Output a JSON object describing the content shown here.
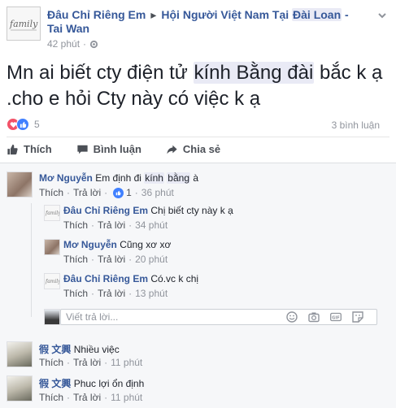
{
  "header": {
    "author": "Đâu Chỉ Riêng Em",
    "group_part1": "Hội Người Việt Nam Tại",
    "group_part2": "Đài Loan",
    "group_part3": "-",
    "group_line2": "Tai Wan",
    "time": "42 phút",
    "logo_text": "family"
  },
  "post": {
    "text_a": "Mn ai biết cty điện tử",
    "text_hl": "kính Bằng đài",
    "text_b": "bắc k ạ .cho e hỏi Cty này có việc k ạ"
  },
  "stats": {
    "reaction_count": "5",
    "comment_count": "3 bình luận"
  },
  "actions": {
    "like": "Thích",
    "comment": "Bình luận",
    "share": "Chia sẻ"
  },
  "comments": [
    {
      "author": "Mơ Nguyễn",
      "text_a": "Em định đi",
      "text_hl1": "kính",
      "text_hl2": "bằng",
      "text_b": "à",
      "like": "Thích",
      "reply": "Trả lời",
      "likes": "1",
      "time": "36 phút"
    },
    {
      "author": "Đâu Chỉ Riêng Em",
      "text": "Chị biết cty này k ạ",
      "like": "Thích",
      "reply": "Trả lời",
      "time": "34 phút"
    },
    {
      "author": "Mơ Nguyễn",
      "text": "Cũng xơ xơ",
      "like": "Thích",
      "reply": "Trả lời",
      "time": "20 phút"
    },
    {
      "author": "Đâu Chỉ Riêng Em",
      "text": "Có.vc k chị",
      "like": "Thích",
      "reply": "Trả lời",
      "time": "13 phút"
    },
    {
      "author": "徦 文興",
      "text": "Nhiều việc",
      "like": "Thích",
      "reply": "Trả lời",
      "time": "11 phút"
    },
    {
      "author": "徦 文興",
      "text": "Phuc lợi ổn định",
      "like": "Thích",
      "reply": "Trả lời",
      "time": "11 phút"
    }
  ],
  "reply_box": {
    "placeholder": "Viết trả lời..."
  },
  "colors": {
    "link": "#365899",
    "like_blue": "#4080ff",
    "love_red": "#f25268",
    "highlight": "#e9eaf5",
    "comment_bg": "#f6f7f9"
  }
}
